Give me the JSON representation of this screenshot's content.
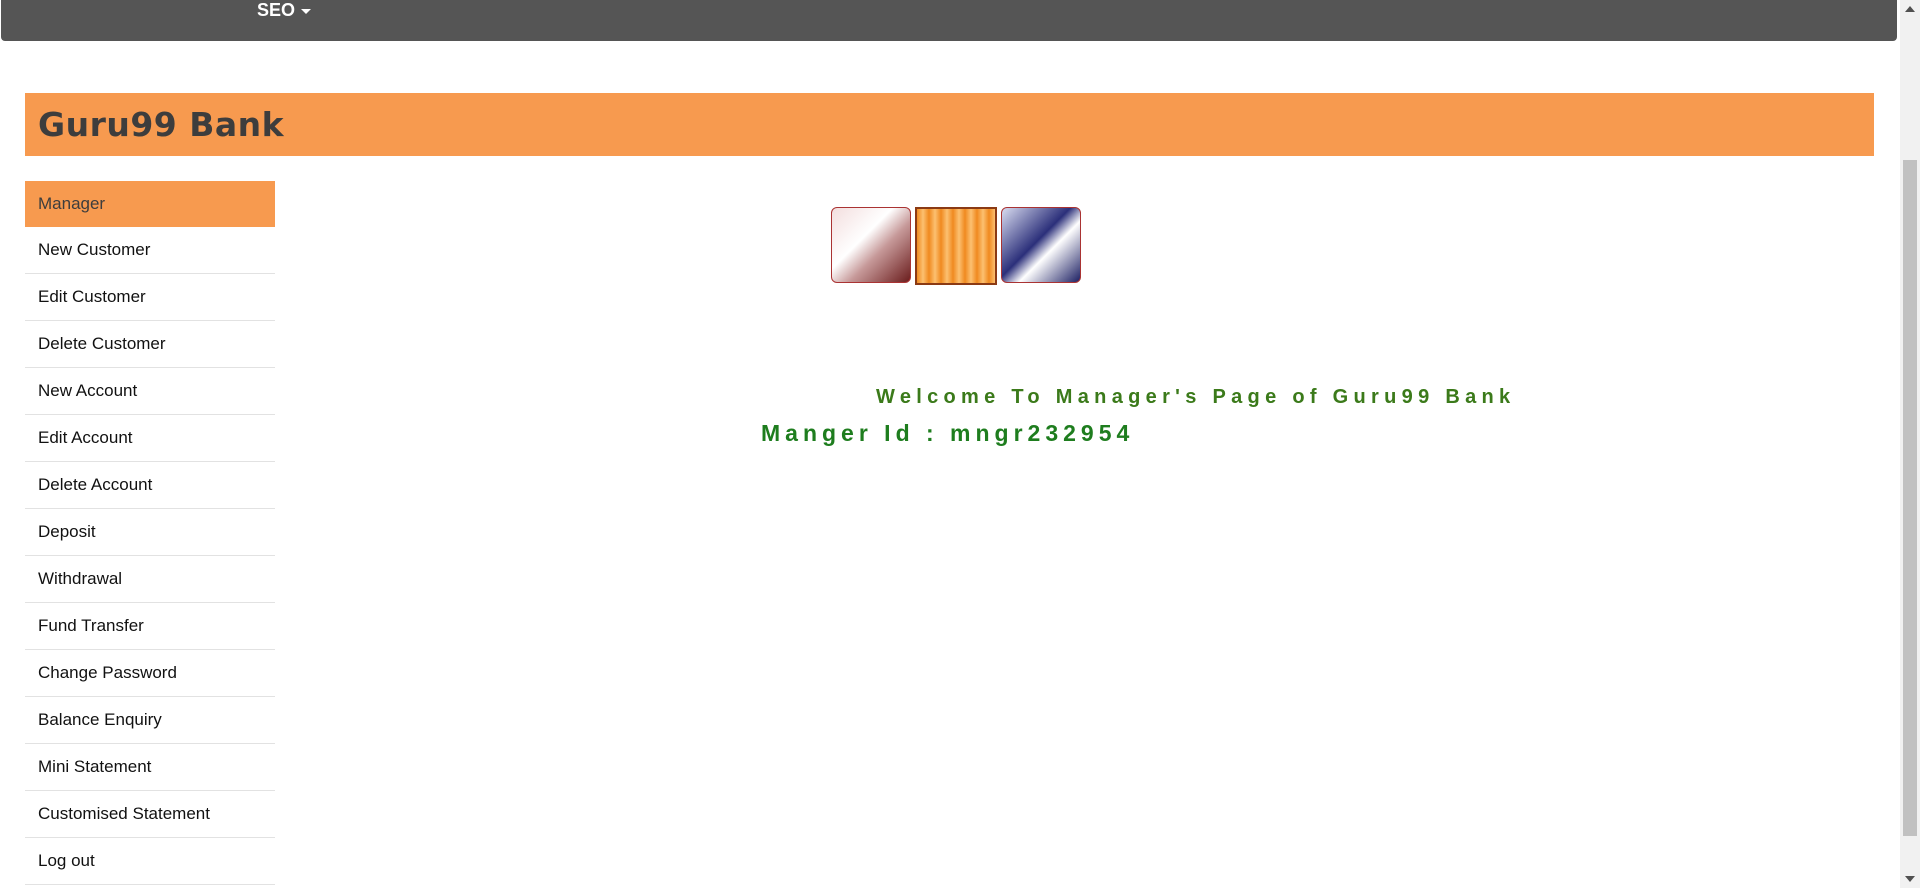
{
  "navbar": {
    "dropdown_label": "SEO"
  },
  "banner": {
    "title": "Guru99 Bank"
  },
  "sidebar": {
    "items": [
      {
        "label": "Manager"
      },
      {
        "label": "New Customer"
      },
      {
        "label": "Edit Customer"
      },
      {
        "label": "Delete Customer"
      },
      {
        "label": "New Account"
      },
      {
        "label": "Edit Account"
      },
      {
        "label": "Delete Account"
      },
      {
        "label": "Deposit"
      },
      {
        "label": "Withdrawal"
      },
      {
        "label": "Fund Transfer"
      },
      {
        "label": "Change Password"
      },
      {
        "label": "Balance Enquiry"
      },
      {
        "label": "Mini Statement"
      },
      {
        "label": "Customised Statement"
      },
      {
        "label": "Log out"
      }
    ]
  },
  "main": {
    "welcome_text": "Welcome To Manager's Page of Guru99 Bank",
    "manager_id_text": "Manger Id : mngr232954"
  },
  "colors": {
    "navbar": "#555555",
    "accent": "#f79a4f",
    "welcome": "#3b7a1a",
    "manager_id": "#1e7d1e"
  }
}
